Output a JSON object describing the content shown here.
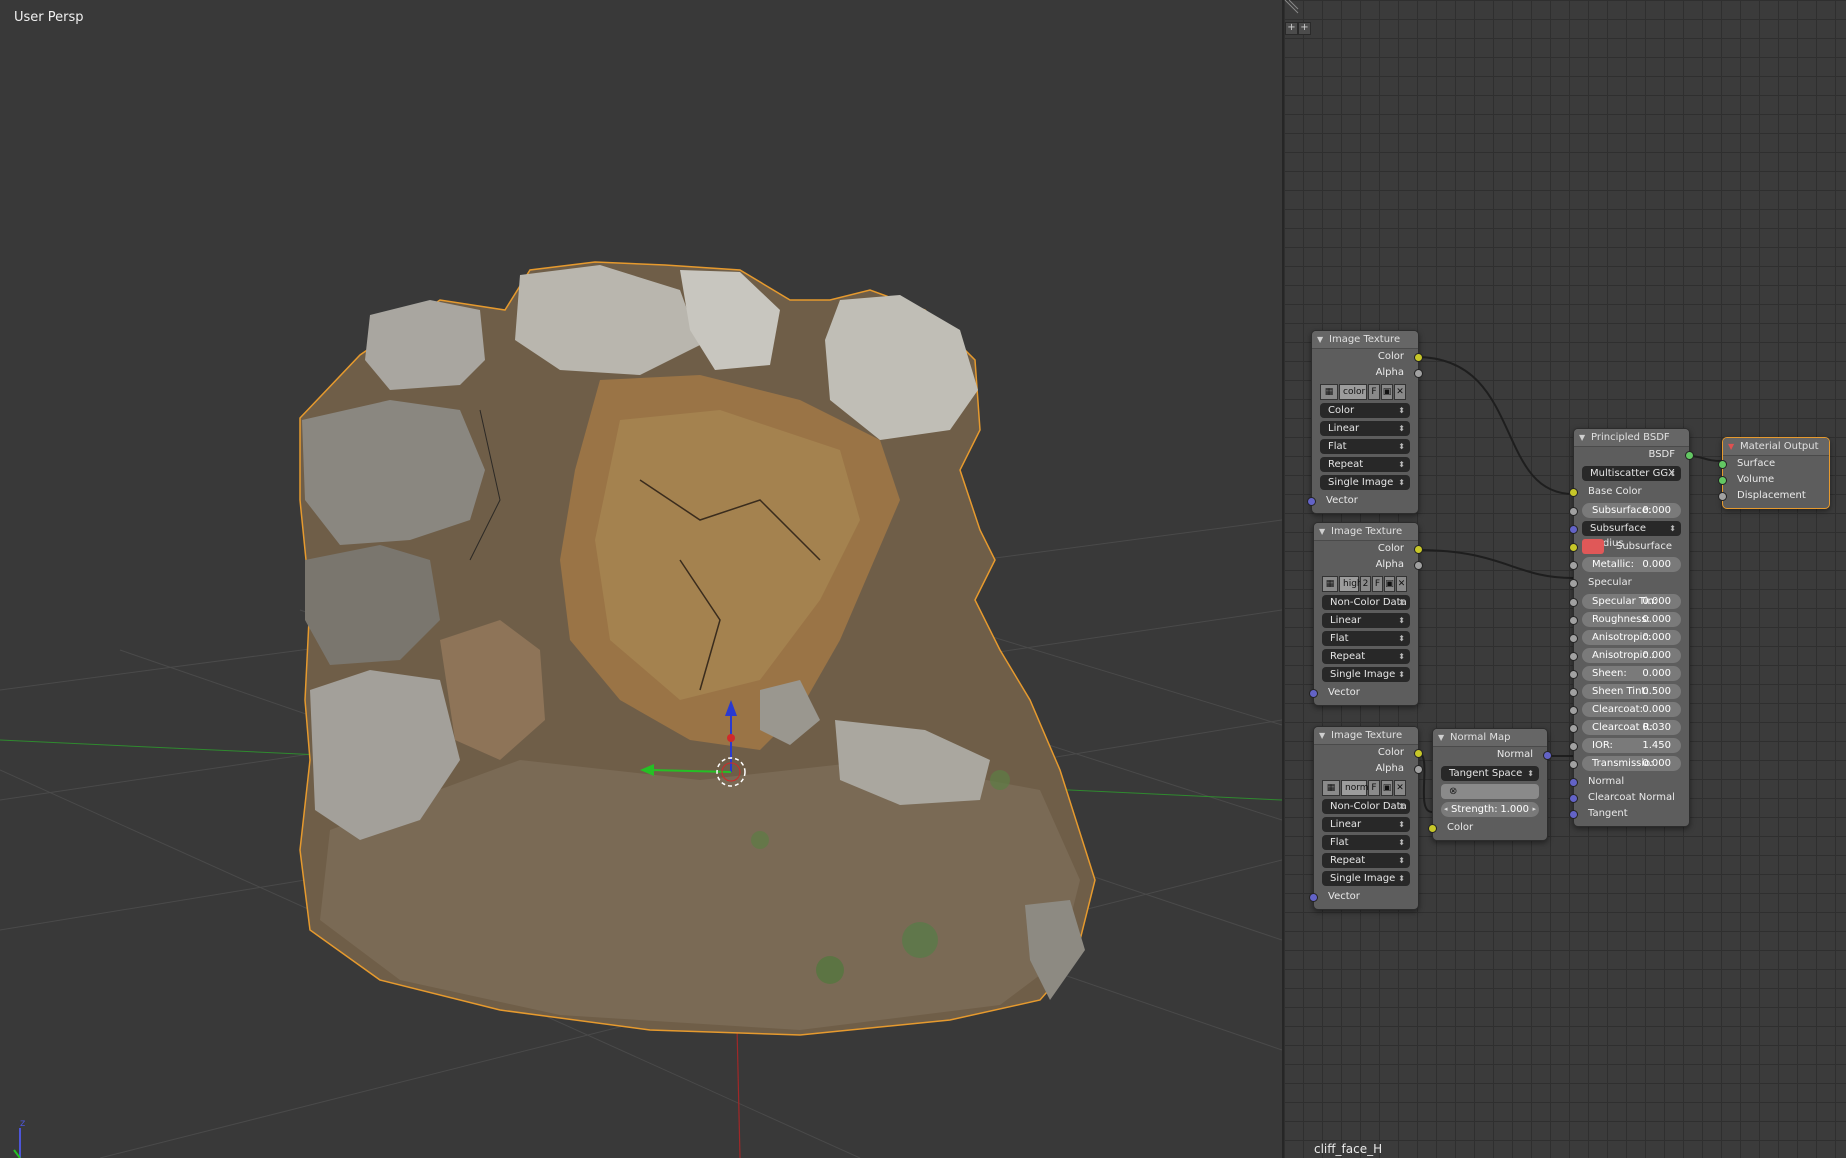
{
  "viewport": {
    "label": "User Persp"
  },
  "editor": {
    "corner_buttons": [
      "+",
      "+"
    ],
    "material_name": "cliff_face_H"
  },
  "nodes": {
    "tex1": {
      "title": "Image Texture",
      "out_color": "Color",
      "out_alpha": "Alpha",
      "image_name": "color",
      "image_f": "F",
      "colorspace": "Color",
      "interpolation": "Linear",
      "projection": "Flat",
      "extension": "Repeat",
      "source": "Single Image",
      "in_vector": "Vector"
    },
    "tex2": {
      "title": "Image Texture",
      "out_color": "Color",
      "out_alpha": "Alpha",
      "image_name": "high",
      "image_users": "2",
      "image_f": "F",
      "colorspace": "Non-Color Data",
      "interpolation": "Linear",
      "projection": "Flat",
      "extension": "Repeat",
      "source": "Single Image",
      "in_vector": "Vector"
    },
    "tex3": {
      "title": "Image Texture",
      "out_color": "Color",
      "out_alpha": "Alpha",
      "image_name": "norm",
      "image_f": "F",
      "colorspace": "Non-Color Data",
      "interpolation": "Linear",
      "projection": "Flat",
      "extension": "Repeat",
      "source": "Single Image",
      "in_vector": "Vector"
    },
    "normalmap": {
      "title": "Normal Map",
      "out_normal": "Normal",
      "space": "Tangent Space",
      "strength_label": "Strength:",
      "strength_value": "1.000",
      "in_color": "Color"
    },
    "bsdf": {
      "title": "Principled BSDF",
      "out_bsdf": "BSDF",
      "distribution": "Multiscatter GGX",
      "base_color": "Base Color",
      "subsurface_label": "Subsurface:",
      "subsurface_value": "0.000",
      "subsurface_radius": "Subsurface Radius",
      "subsurface_color": "Subsurface Co",
      "metallic_label": "Metallic:",
      "metallic_value": "0.000",
      "specular": "Specular",
      "specular_tint_label": "Specular Tin:",
      "specular_tint_value": "0.000",
      "roughness_label": "Roughness:",
      "roughness_value": "0.000",
      "anisotropic_label": "Anisotropic:",
      "anisotropic_value": "0.000",
      "anisotropic_rot_label": "Anisotropic :",
      "anisotropic_rot_value": "0.000",
      "sheen_label": "Sheen:",
      "sheen_value": "0.000",
      "sheen_tint_label": "Sheen Tint:",
      "sheen_tint_value": "0.500",
      "clearcoat_label": "Clearcoat:",
      "clearcoat_value": "0.000",
      "clearcoat_r_label": "Clearcoat R:",
      "clearcoat_r_value": "0.030",
      "ior_label": "IOR:",
      "ior_value": "1.450",
      "transmission_label": "Transmissio:",
      "transmission_value": "0.000",
      "in_normal": "Normal",
      "in_clearcoat_normal": "Clearcoat Normal",
      "in_tangent": "Tangent"
    },
    "output": {
      "title": "Material Output",
      "in_surface": "Surface",
      "in_volume": "Volume",
      "in_displacement": "Displacement"
    }
  },
  "colors": {
    "socket_color": "#c7c729",
    "socket_float": "#a1a1a1",
    "socket_vector": "#6363c7",
    "socket_shader": "#63c763",
    "selection": "#e69a2e",
    "subsurface_swatch": "#e05858"
  }
}
